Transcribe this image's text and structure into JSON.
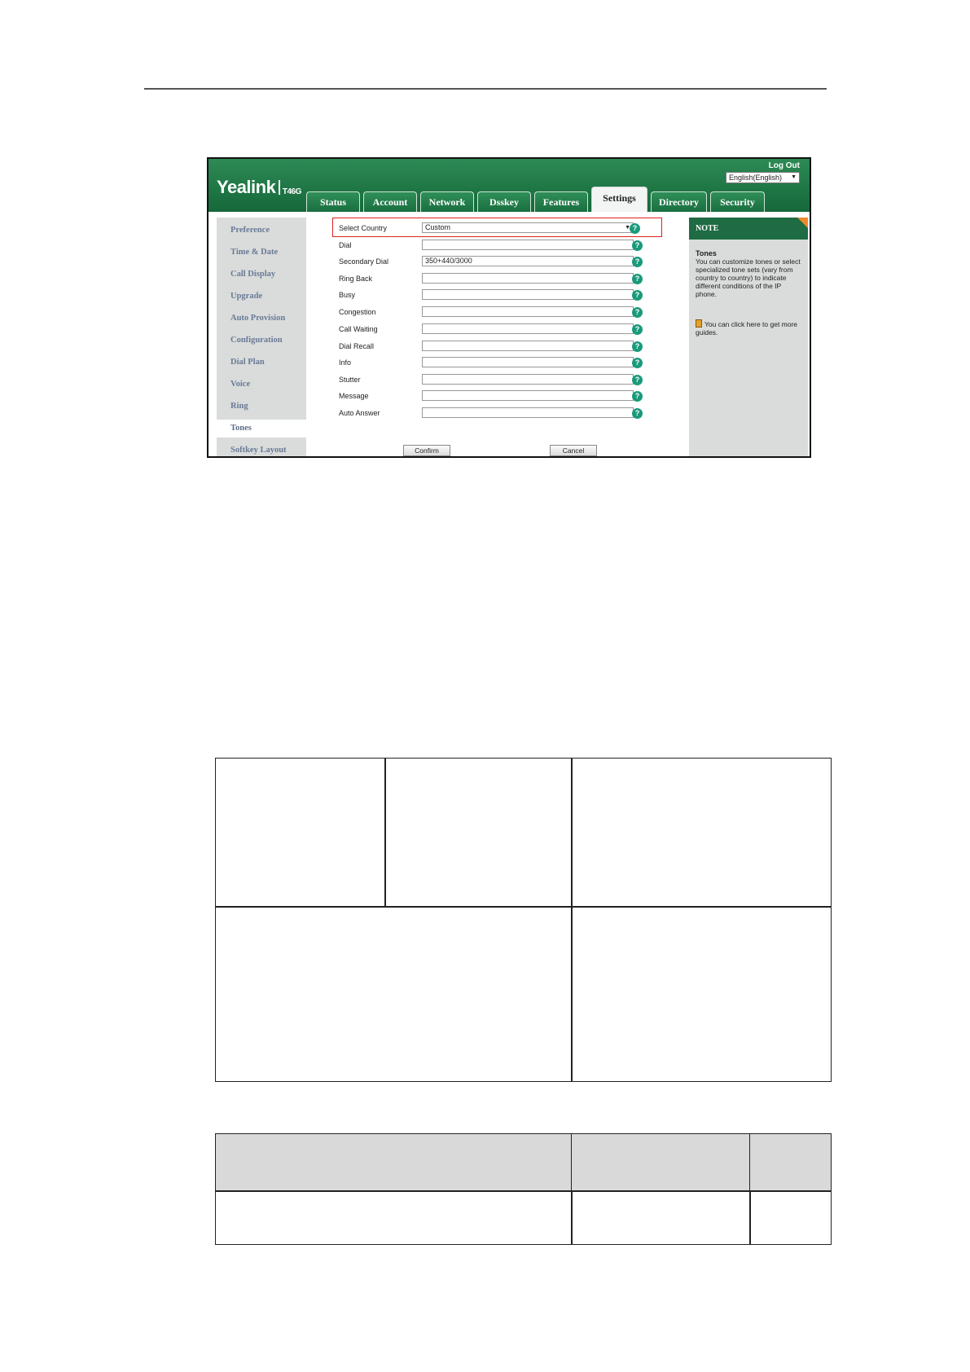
{
  "header": {
    "logo": "Yealink",
    "model": "T46G",
    "logout": "Log Out",
    "language": "English(English)"
  },
  "tabs": [
    {
      "label": "Status",
      "active": false
    },
    {
      "label": "Account",
      "active": false
    },
    {
      "label": "Network",
      "active": false
    },
    {
      "label": "Dsskey",
      "active": false
    },
    {
      "label": "Features",
      "active": false
    },
    {
      "label": "Settings",
      "active": true
    },
    {
      "label": "Directory",
      "active": false
    },
    {
      "label": "Security",
      "active": false
    }
  ],
  "sidebar": {
    "items": [
      {
        "label": "Preference",
        "active": false
      },
      {
        "label": "Time & Date",
        "active": false
      },
      {
        "label": "Call Display",
        "active": false
      },
      {
        "label": "Upgrade",
        "active": false
      },
      {
        "label": "Auto Provision",
        "active": false
      },
      {
        "label": "Configuration",
        "active": false
      },
      {
        "label": "Dial Plan",
        "active": false
      },
      {
        "label": "Voice",
        "active": false
      },
      {
        "label": "Ring",
        "active": false
      },
      {
        "label": "Tones",
        "active": true
      },
      {
        "label": "Softkey Layout",
        "active": false
      }
    ]
  },
  "form": {
    "select_country": {
      "label": "Select Country",
      "value": "Custom"
    },
    "fields": [
      {
        "label": "Dial",
        "value": ""
      },
      {
        "label": "Secondary Dial",
        "value": "350+440/3000"
      },
      {
        "label": "Ring Back",
        "value": ""
      },
      {
        "label": "Busy",
        "value": ""
      },
      {
        "label": "Congestion",
        "value": ""
      },
      {
        "label": "Call Waiting",
        "value": ""
      },
      {
        "label": "Dial Recall",
        "value": ""
      },
      {
        "label": "Info",
        "value": ""
      },
      {
        "label": "Stutter",
        "value": ""
      },
      {
        "label": "Message",
        "value": ""
      },
      {
        "label": "Auto Answer",
        "value": ""
      }
    ],
    "help_glyph": "?",
    "confirm": "Confirm",
    "cancel": "Cancel"
  },
  "note": {
    "heading": "NOTE",
    "title": "Tones",
    "text": "You can customize tones or select specialized tone sets (vary from country to country) to indicate different conditions of the IP phone.",
    "link": "You can click here to get more guides."
  },
  "colors": {
    "brand_green": "#1a6e40",
    "highlight_red": "#e02020",
    "help_teal": "#1a9a7a",
    "note_corner": "#f0892d"
  }
}
